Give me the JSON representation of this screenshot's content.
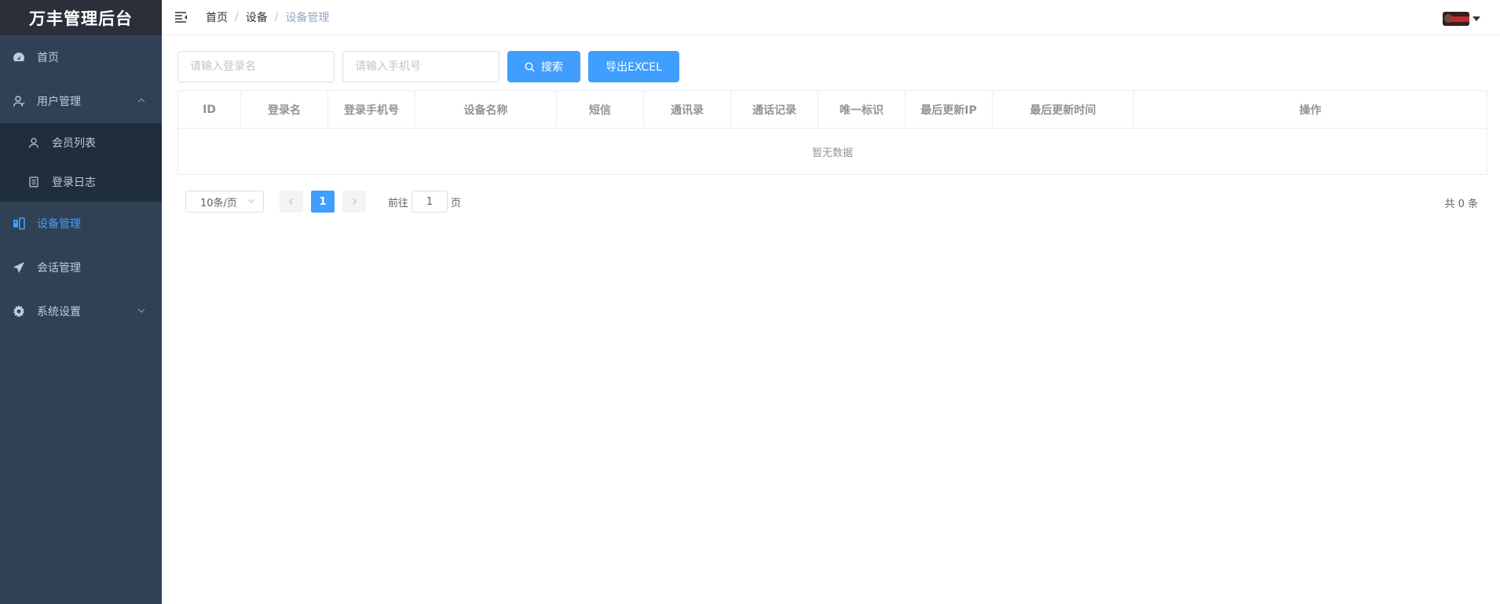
{
  "app": {
    "title": "万丰管理后台"
  },
  "sidebar": {
    "items": [
      {
        "label": "首页",
        "icon": "dashboard-icon"
      },
      {
        "label": "用户管理",
        "icon": "user-icon",
        "expanded": true,
        "children": [
          {
            "label": "会员列表",
            "icon": "user-outline-icon"
          },
          {
            "label": "登录日志",
            "icon": "document-icon"
          }
        ]
      },
      {
        "label": "设备管理",
        "icon": "device-icon",
        "active": true
      },
      {
        "label": "会话管理",
        "icon": "paper-plane-icon"
      },
      {
        "label": "系统设置",
        "icon": "gear-icon",
        "expanded": false
      }
    ],
    "colors": {
      "background": "#304156",
      "submenu": "#1f2d3d",
      "text": "#bfcbd9",
      "active": "#409eff"
    }
  },
  "navbar": {
    "breadcrumb": [
      "首页",
      "设备",
      "设备管理"
    ]
  },
  "filter": {
    "login_name_placeholder": "请输入登录名",
    "phone_placeholder": "请输入手机号",
    "search_label": "搜索",
    "export_label": "导出EXCEL"
  },
  "table": {
    "columns": [
      "ID",
      "登录名",
      "登录手机号",
      "设备名称",
      "短信",
      "通讯录",
      "通话记录",
      "唯一标识",
      "最后更新IP",
      "最后更新时间",
      "操作"
    ],
    "empty_text": "暂无数据",
    "rows": []
  },
  "pagination": {
    "page_size": "10条/页",
    "current_page": "1",
    "goto_label": "前往",
    "goto_value": "1",
    "page_unit": "页",
    "total_text": "共 0 条"
  },
  "colors": {
    "primary": "#409eff"
  }
}
